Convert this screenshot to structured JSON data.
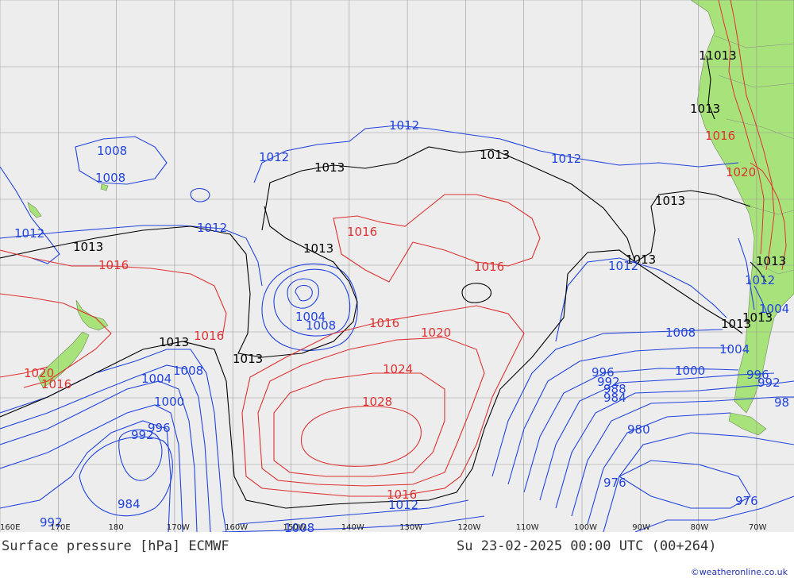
{
  "map": {
    "title": "Surface pressure [hPa] ECMWF",
    "valid_time": "Su 23-02-2025 00:00 UTC (00+264)",
    "credit": "©weatheronline.co.uk",
    "longitude_ticks": [
      "160E",
      "170E",
      "180",
      "170W",
      "160W",
      "150W",
      "140W",
      "130W",
      "120W",
      "110W",
      "100W",
      "90W",
      "80W",
      "70W"
    ],
    "colors": {
      "background": "#ededed",
      "land": "#a8e27a",
      "grid": "#9a9a9a",
      "low_isobar": "#2244dd",
      "standard_isobar": "#000000",
      "high_isobar": "#dd3333"
    },
    "contour_labels": [
      {
        "text": "1013",
        "kind": "standard"
      },
      {
        "text": "1013",
        "kind": "standard"
      },
      {
        "text": "1013",
        "kind": "standard"
      },
      {
        "text": "1013",
        "kind": "standard"
      },
      {
        "text": "1013",
        "kind": "standard"
      },
      {
        "text": "1013",
        "kind": "standard"
      },
      {
        "text": "1013",
        "kind": "standard"
      },
      {
        "text": "1013",
        "kind": "standard"
      },
      {
        "text": "1013",
        "kind": "standard"
      },
      {
        "text": "1013",
        "kind": "standard"
      },
      {
        "text": "11013",
        "kind": "standard"
      },
      {
        "text": "1013",
        "kind": "standard"
      },
      {
        "text": "1013",
        "kind": "standard"
      },
      {
        "text": "1012",
        "kind": "low"
      },
      {
        "text": "1012",
        "kind": "low"
      },
      {
        "text": "1012",
        "kind": "low"
      },
      {
        "text": "1012",
        "kind": "low"
      },
      {
        "text": "1012",
        "kind": "low"
      },
      {
        "text": "1012",
        "kind": "low"
      },
      {
        "text": "1012",
        "kind": "low"
      },
      {
        "text": "1012",
        "kind": "low"
      },
      {
        "text": "1008",
        "kind": "low"
      },
      {
        "text": "1008",
        "kind": "low"
      },
      {
        "text": "1008",
        "kind": "low"
      },
      {
        "text": "1008",
        "kind": "low"
      },
      {
        "text": "1008",
        "kind": "low"
      },
      {
        "text": "1008",
        "kind": "low"
      },
      {
        "text": "1004",
        "kind": "low"
      },
      {
        "text": "1004",
        "kind": "low"
      },
      {
        "text": "1004",
        "kind": "low"
      },
      {
        "text": "1004",
        "kind": "low"
      },
      {
        "text": "1000",
        "kind": "low"
      },
      {
        "text": "1000",
        "kind": "low"
      },
      {
        "text": "996",
        "kind": "low"
      },
      {
        "text": "996",
        "kind": "low"
      },
      {
        "text": "996",
        "kind": "low"
      },
      {
        "text": "992",
        "kind": "low"
      },
      {
        "text": "992",
        "kind": "low"
      },
      {
        "text": "992",
        "kind": "low"
      },
      {
        "text": "992",
        "kind": "low"
      },
      {
        "text": "988",
        "kind": "low"
      },
      {
        "text": "98",
        "kind": "low"
      },
      {
        "text": "984",
        "kind": "low"
      },
      {
        "text": "984",
        "kind": "low"
      },
      {
        "text": "980",
        "kind": "low"
      },
      {
        "text": "976",
        "kind": "low"
      },
      {
        "text": "976",
        "kind": "low"
      },
      {
        "text": "1016",
        "kind": "high"
      },
      {
        "text": "1016",
        "kind": "high"
      },
      {
        "text": "1016",
        "kind": "high"
      },
      {
        "text": "1016",
        "kind": "high"
      },
      {
        "text": "1016",
        "kind": "high"
      },
      {
        "text": "1016",
        "kind": "high"
      },
      {
        "text": "1016",
        "kind": "high"
      },
      {
        "text": "1016",
        "kind": "high"
      },
      {
        "text": "1020",
        "kind": "high"
      },
      {
        "text": "1020",
        "kind": "high"
      },
      {
        "text": "1020",
        "kind": "high"
      },
      {
        "text": "1024",
        "kind": "high"
      },
      {
        "text": "1028",
        "kind": "high"
      }
    ]
  }
}
